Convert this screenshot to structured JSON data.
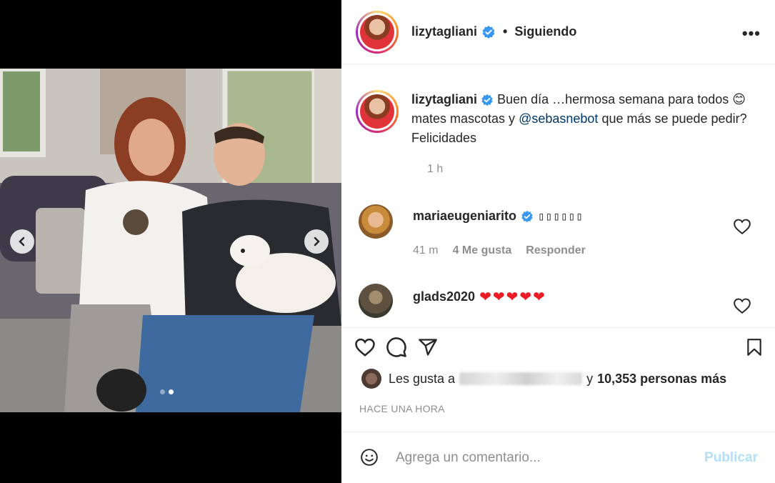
{
  "post": {
    "username": "lizytagliani",
    "separator": "•",
    "follow_status": "Siguiendo",
    "more_label": "•••",
    "carousel": {
      "current_index": 2,
      "total": 2
    }
  },
  "caption": {
    "username": "lizytagliani",
    "text_before": "Buen día …hermosa semana para todos",
    "emoji": "😊",
    "text_middle": "mates mascotas y",
    "mention": "@sebasnebot",
    "text_after": "que más se puede pedir? Felicidades",
    "time": "1 h"
  },
  "comments": [
    {
      "username": "mariaeugeniarito",
      "text": "▯▯▯▯▯▯",
      "time": "41 m",
      "likes": "4 Me gusta",
      "reply_label": "Responder"
    },
    {
      "username": "glads2020",
      "text": "❤❤❤❤❤"
    }
  ],
  "likes": {
    "prefix": "Les gusta a",
    "suffix": "y",
    "count_text": "10,353 personas más"
  },
  "timestamp": "HACE UNA HORA",
  "comment_box": {
    "placeholder": "Agrega un comentario...",
    "publish_label": "Publicar"
  },
  "colors": {
    "verified": "#3897f0",
    "mention": "#00376b",
    "publish_disabled": "#b2dffc",
    "heart_red": "#ed1c24"
  }
}
